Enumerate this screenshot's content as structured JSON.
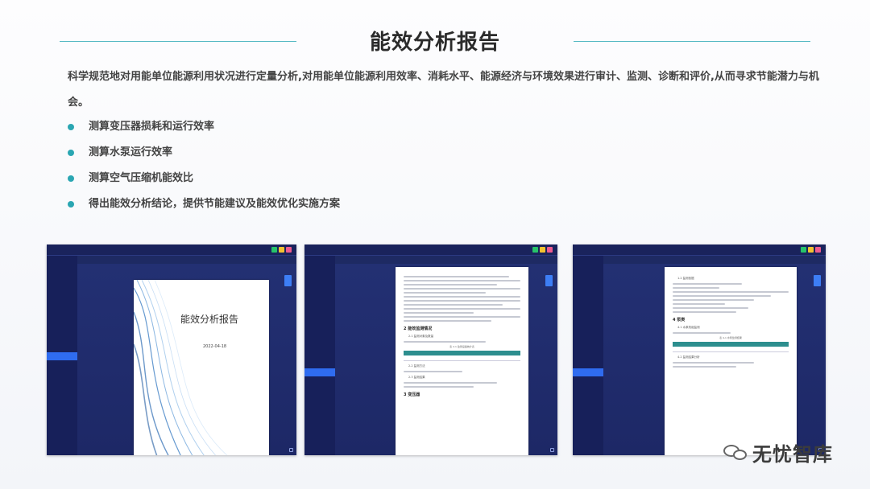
{
  "title": "能效分析报告",
  "intro": "科学规范地对用能单位能源利用状况进行定量分析,对用能单位能源利用效率、消耗水平、能源经济与环境效果进行审计、监测、诊断和评价,从而寻求节能潜力与机会。",
  "bullets": [
    "测算变压器损耗和运行效率",
    "测算水泵运行效率",
    "测算空气压缩机能效比",
    "得出能效分析结论，提供节能建议及能效优化实施方案"
  ],
  "screens": {
    "cover": {
      "title": "能效分析报告",
      "date": "2022-04-18"
    },
    "doc2": {
      "heading1": "2 能效监测情况",
      "sub1": "2.1 监测对象及数量",
      "caption1": "表 2-1 监测设备统计表",
      "sub2": "2.2 监测方法",
      "sub3": "2.3 监测结果",
      "heading2": "3 变压器"
    },
    "doc3": {
      "sub1": "1.2 监测依据",
      "heading1": "4 泵类",
      "sub2": "4.1 水泵机组监测",
      "caption1": "表 4-1 水泵监测结果",
      "sub3": "4.2 监测结果分析"
    }
  },
  "watermark": {
    "text": "无忧智库"
  },
  "colors": {
    "accent": "#2aa6b2",
    "app_bg": "#1e2a63",
    "active_menu": "#2f6cf0"
  }
}
